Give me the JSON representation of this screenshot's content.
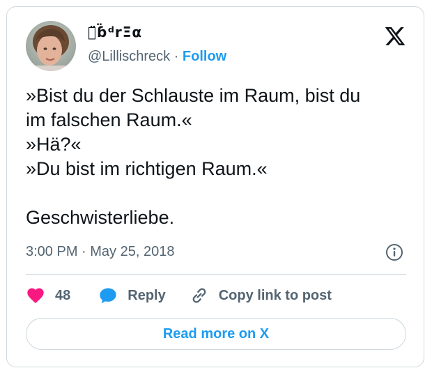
{
  "tweet": {
    "author": {
      "display_name": "ด̈ɓ̈ᵈrΞα",
      "handle": "@Lillischreck",
      "separator": "·",
      "follow_label": "Follow",
      "avatar": "profile-photo"
    },
    "platform_icon": "x-logo-icon",
    "text_lines": [
      "»Bist du der Schlauste im Raum, bist du",
      "im falschen Raum.«",
      "»Hä?«",
      "»Du bist im richtigen Raum.«"
    ],
    "closing_line": "Geschwisterliebe.",
    "timestamp": "3:00 PM · May 25, 2018",
    "info_icon": "info-icon"
  },
  "actions": {
    "like_icon": "heart-icon",
    "like_count": "48",
    "reply_icon": "reply-bubble-icon",
    "reply_label": "Reply",
    "copy_icon": "link-icon",
    "copy_label": "Copy link to post"
  },
  "footer": {
    "read_more_label": "Read more on X"
  },
  "colors": {
    "accent": "#1d9bf0",
    "like": "#f91880",
    "text": "#0f1419",
    "secondary": "#536471",
    "border": "#cfd9de"
  }
}
